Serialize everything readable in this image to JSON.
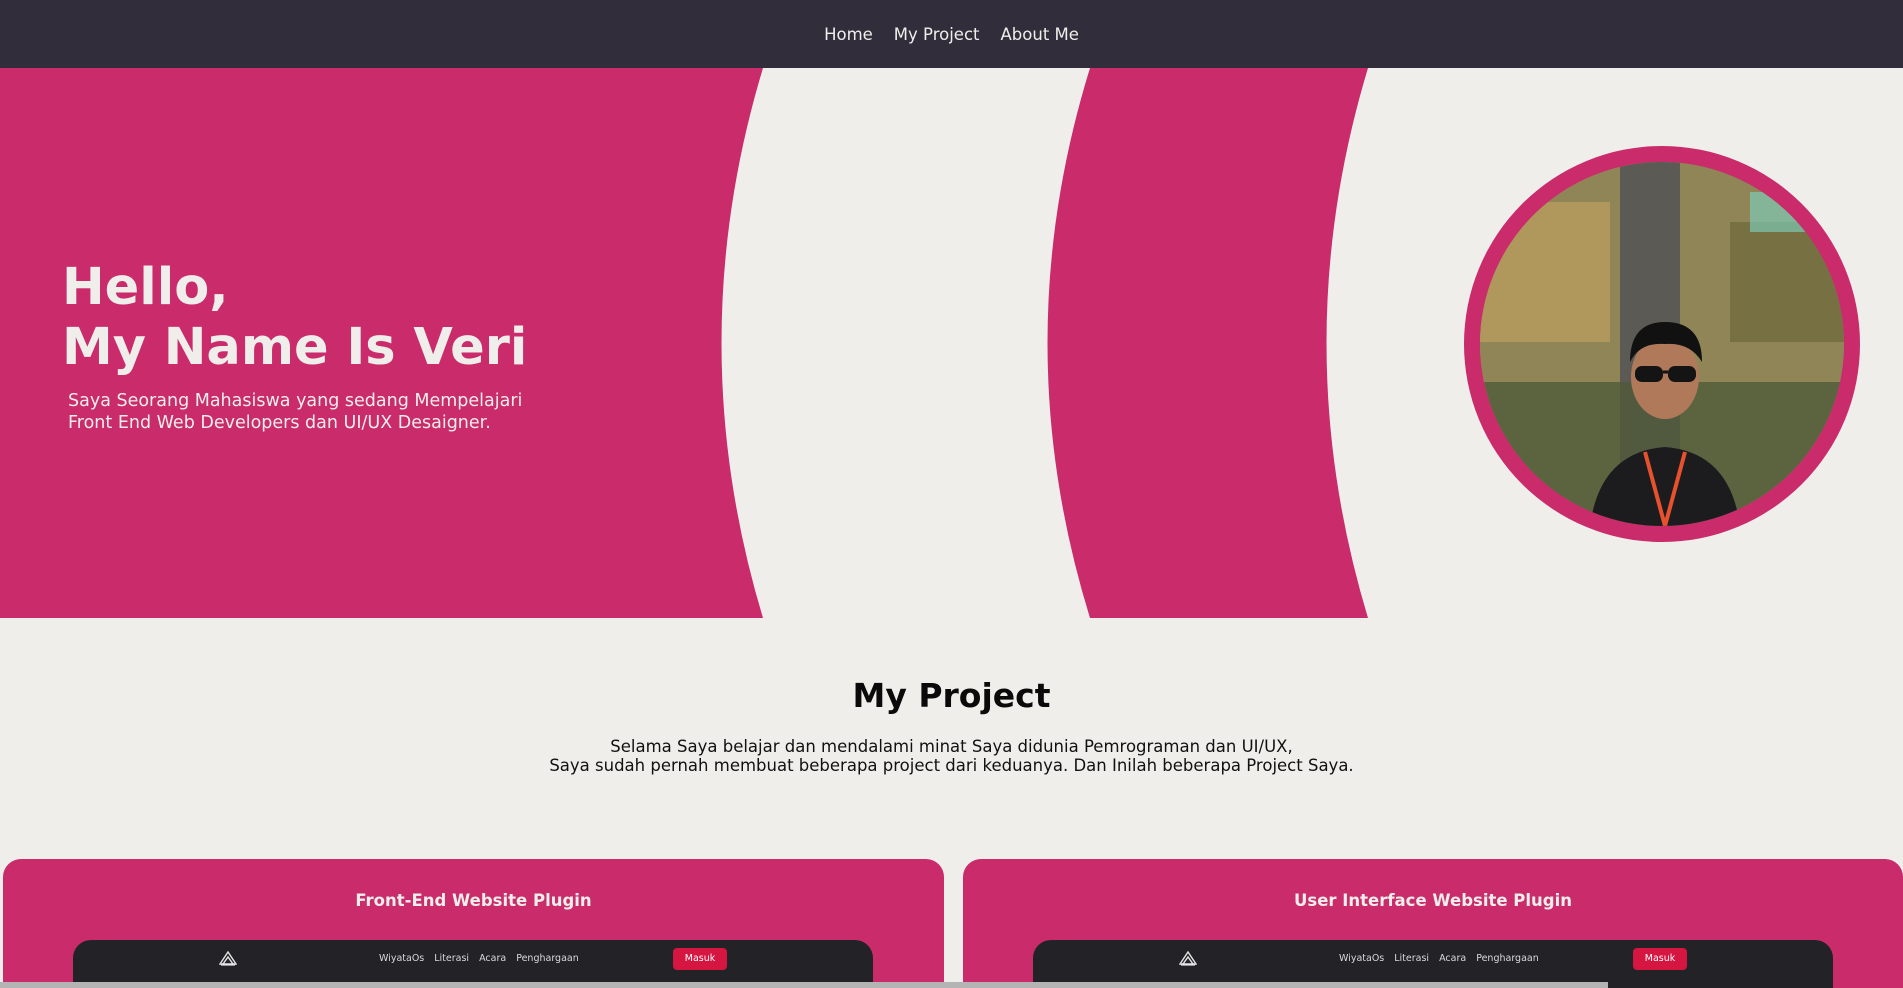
{
  "nav": {
    "items": [
      "Home",
      "My Project",
      "About Me"
    ]
  },
  "hero": {
    "title_line1": "Hello,",
    "title_line2": "My Name Is Veri",
    "subtitle_line1": "Saya Seorang Mahasiswa yang sedang Mempelajari",
    "subtitle_line2": "Front End Web Developers dan UI/UX Desaigner."
  },
  "projects": {
    "title": "My Project",
    "desc_line1": "Selama Saya belajar dan mendalami minat Saya didunia Pemrograman dan UI/UX,",
    "desc_line2": "Saya sudah pernah membuat beberapa project dari keduanya. Dan Inilah beberapa Project Saya.",
    "cards": [
      {
        "title": "Front-End Website Plugin",
        "links": [
          "WiyataOs",
          "Literasi",
          "Acara",
          "Penghargaan"
        ],
        "button": "Masuk"
      },
      {
        "title": "User Interface Website Plugin",
        "links": [
          "WiyataOs",
          "Literasi",
          "Acara",
          "Penghargaan"
        ],
        "button": "Masuk"
      }
    ]
  },
  "colors": {
    "nav_bg": "#312d3b",
    "accent": "#c92b6b",
    "page_bg": "#f0eeeb",
    "button": "#d41640"
  },
  "icons": {
    "profile_photo": "profile-photo",
    "mock_logo": "mountain-logo-icon"
  }
}
